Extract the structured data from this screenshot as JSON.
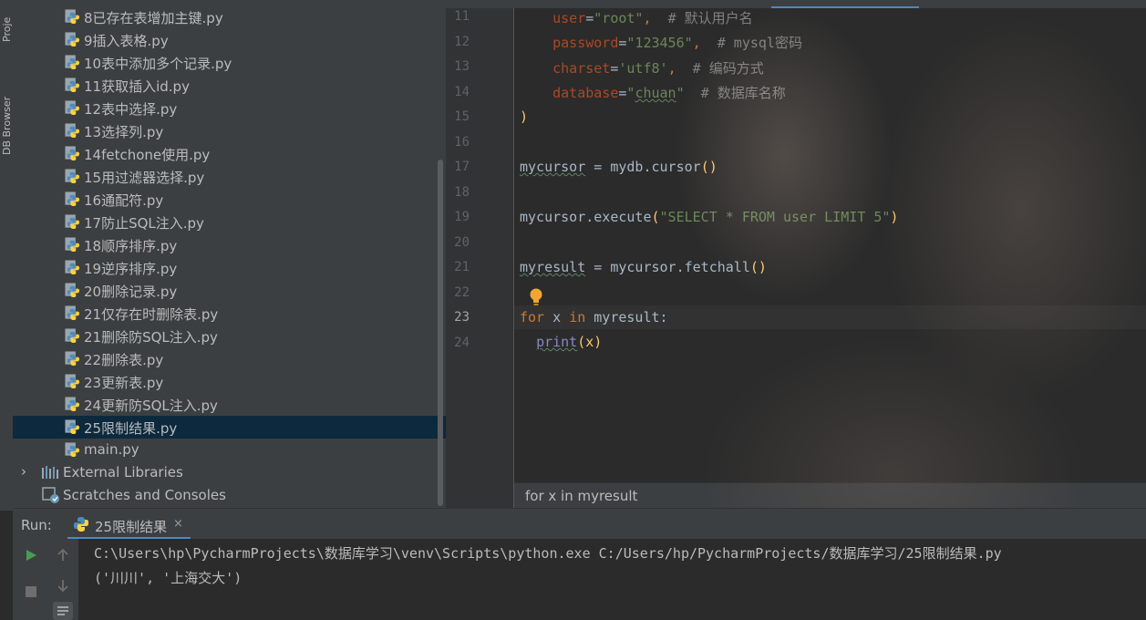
{
  "tool_strip": {
    "project_tab": "Proje",
    "db_browser_tab": "DB Browser"
  },
  "project_tree": {
    "items": [
      {
        "label": "8已存在表增加主键.py",
        "icon": "python-file-icon"
      },
      {
        "label": "9插入表格.py",
        "icon": "python-file-icon"
      },
      {
        "label": "10表中添加多个记录.py",
        "icon": "python-file-icon"
      },
      {
        "label": "11获取插入id.py",
        "icon": "python-file-icon"
      },
      {
        "label": "12表中选择.py",
        "icon": "python-file-icon"
      },
      {
        "label": "13选择列.py",
        "icon": "python-file-icon"
      },
      {
        "label": "14fetchone使用.py",
        "icon": "python-file-icon"
      },
      {
        "label": "15用过滤器选择.py",
        "icon": "python-file-icon"
      },
      {
        "label": "16通配符.py",
        "icon": "python-file-icon"
      },
      {
        "label": "17防止SQL注入.py",
        "icon": "python-file-icon"
      },
      {
        "label": "18顺序排序.py",
        "icon": "python-file-icon"
      },
      {
        "label": "19逆序排序.py",
        "icon": "python-file-icon"
      },
      {
        "label": "20删除记录.py",
        "icon": "python-file-icon"
      },
      {
        "label": "21仅存在时删除表.py",
        "icon": "python-file-icon"
      },
      {
        "label": "21删除防SQL注入.py",
        "icon": "python-file-icon"
      },
      {
        "label": "22删除表.py",
        "icon": "python-file-icon"
      },
      {
        "label": "23更新表.py",
        "icon": "python-file-icon"
      },
      {
        "label": "24更新防SQL注入.py",
        "icon": "python-file-icon"
      },
      {
        "label": "25限制结果.py",
        "icon": "python-file-icon",
        "selected": true
      },
      {
        "label": "main.py",
        "icon": "python-file-icon"
      }
    ],
    "external_libraries": "External Libraries",
    "scratches": "Scratches and Consoles"
  },
  "editor": {
    "line_numbers": [
      "11",
      "12",
      "13",
      "14",
      "15",
      "16",
      "17",
      "18",
      "19",
      "20",
      "21",
      "22",
      "23",
      "24"
    ],
    "current_line": "23",
    "lines": {
      "l11_param": "user",
      "l11_eq": "=",
      "l11_val": "\"root\"",
      "l11_comma": ",",
      "l11_comment": "# 默认用户名",
      "l12_param": "password",
      "l12_eq": "=",
      "l12_val": "\"123456\"",
      "l12_comma": ",",
      "l12_comment": "# mysql密码",
      "l13_param": "charset",
      "l13_eq": "=",
      "l13_val": "'utf8'",
      "l13_comma": ",",
      "l13_comment": "# 编码方式",
      "l14_param": "database",
      "l14_eq": "=",
      "l14_val_q1": "\"",
      "l14_val": "chuan",
      "l14_val_q2": "\"",
      "l14_comment": "# 数据库名称",
      "l15": ")",
      "l17_var": "mycursor",
      "l17_rest": " = mydb.cursor",
      "l17_paren": "()",
      "l19_a": "mycursor.execute",
      "l19_p1": "(",
      "l19_str": "\"SELECT * FROM user LIMIT 5\"",
      "l19_p2": ")",
      "l21_var": "myresult",
      "l21_rest": " = mycursor.fetchall",
      "l21_paren": "()",
      "l23_for": "for",
      "l23_x": " x ",
      "l23_in": "in",
      "l23_rest": " myresult:",
      "l24_print": "print",
      "l24_args": "(x)"
    },
    "breadcrumb": "for x in myresult"
  },
  "run_panel": {
    "label": "Run:",
    "tab_label": "25限制结果",
    "close": "×",
    "output": [
      "C:\\Users\\hp\\PycharmProjects\\数据库学习\\venv\\Scripts\\python.exe C:/Users/hp/PycharmProjects/数据库学习/25限制结果.py",
      "('川川', '上海交大')"
    ]
  }
}
